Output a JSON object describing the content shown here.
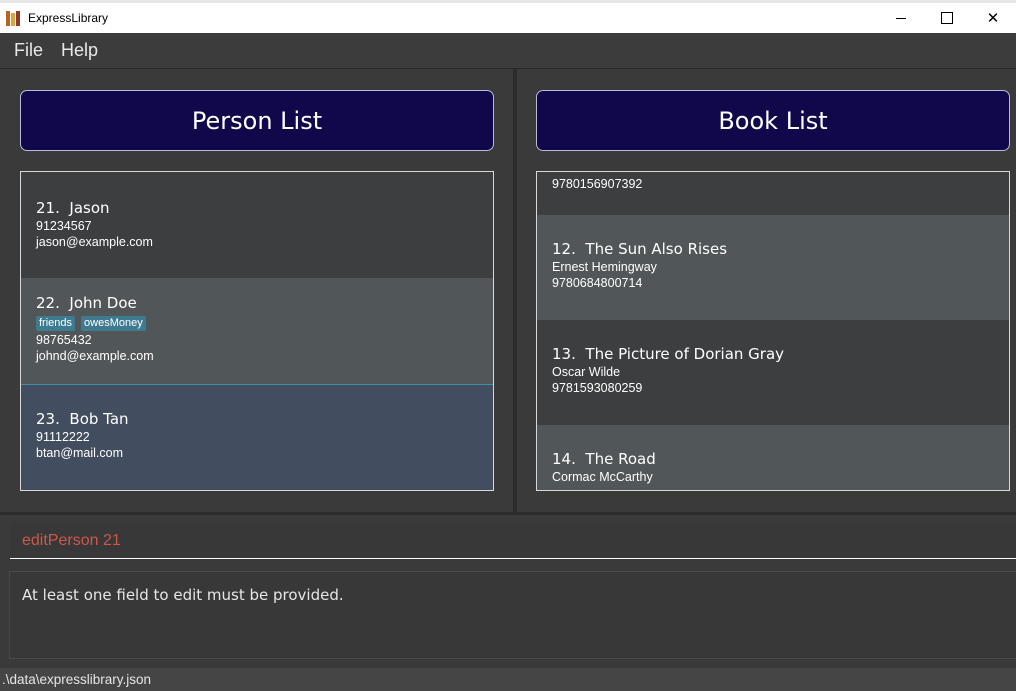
{
  "window": {
    "title": "ExpressLibrary",
    "close_glyph": "✕"
  },
  "menu": {
    "items": [
      "File",
      "Help"
    ]
  },
  "person_panel": {
    "header": "Person List",
    "persons": [
      {
        "index": "21.",
        "name": "Jason",
        "tags": [],
        "phone": "91234567",
        "email": "jason@example.com"
      },
      {
        "index": "22.",
        "name": "John Doe",
        "tags": [
          "friends",
          "owesMoney"
        ],
        "phone": "98765432",
        "email": "johnd@example.com"
      },
      {
        "index": "23.",
        "name": "Bob Tan",
        "tags": [],
        "phone": "91112222",
        "email": "btan@mail.com"
      }
    ]
  },
  "book_panel": {
    "header": "Book List",
    "books": [
      {
        "index": "",
        "title": "",
        "author": "",
        "isbn": "9780156907392"
      },
      {
        "index": "12.",
        "title": "The Sun Also Rises",
        "author": "Ernest Hemingway",
        "isbn": "9780684800714"
      },
      {
        "index": "13.",
        "title": "The Picture of Dorian Gray",
        "author": "Oscar Wilde",
        "isbn": "9781593080259"
      },
      {
        "index": "14.",
        "title": "The Road",
        "author": "Cormac McCarthy",
        "isbn": ""
      }
    ]
  },
  "command": {
    "value": "editPerson 21"
  },
  "result": {
    "message": "At least one field to edit must be provided."
  },
  "status": {
    "file_path": ".\\data\\expresslibrary.json"
  },
  "colors": {
    "header_bg": "#10084a",
    "tag_bg": "#3e7b91",
    "command_text": "#d0564a",
    "selected_row": "#424d5f"
  }
}
